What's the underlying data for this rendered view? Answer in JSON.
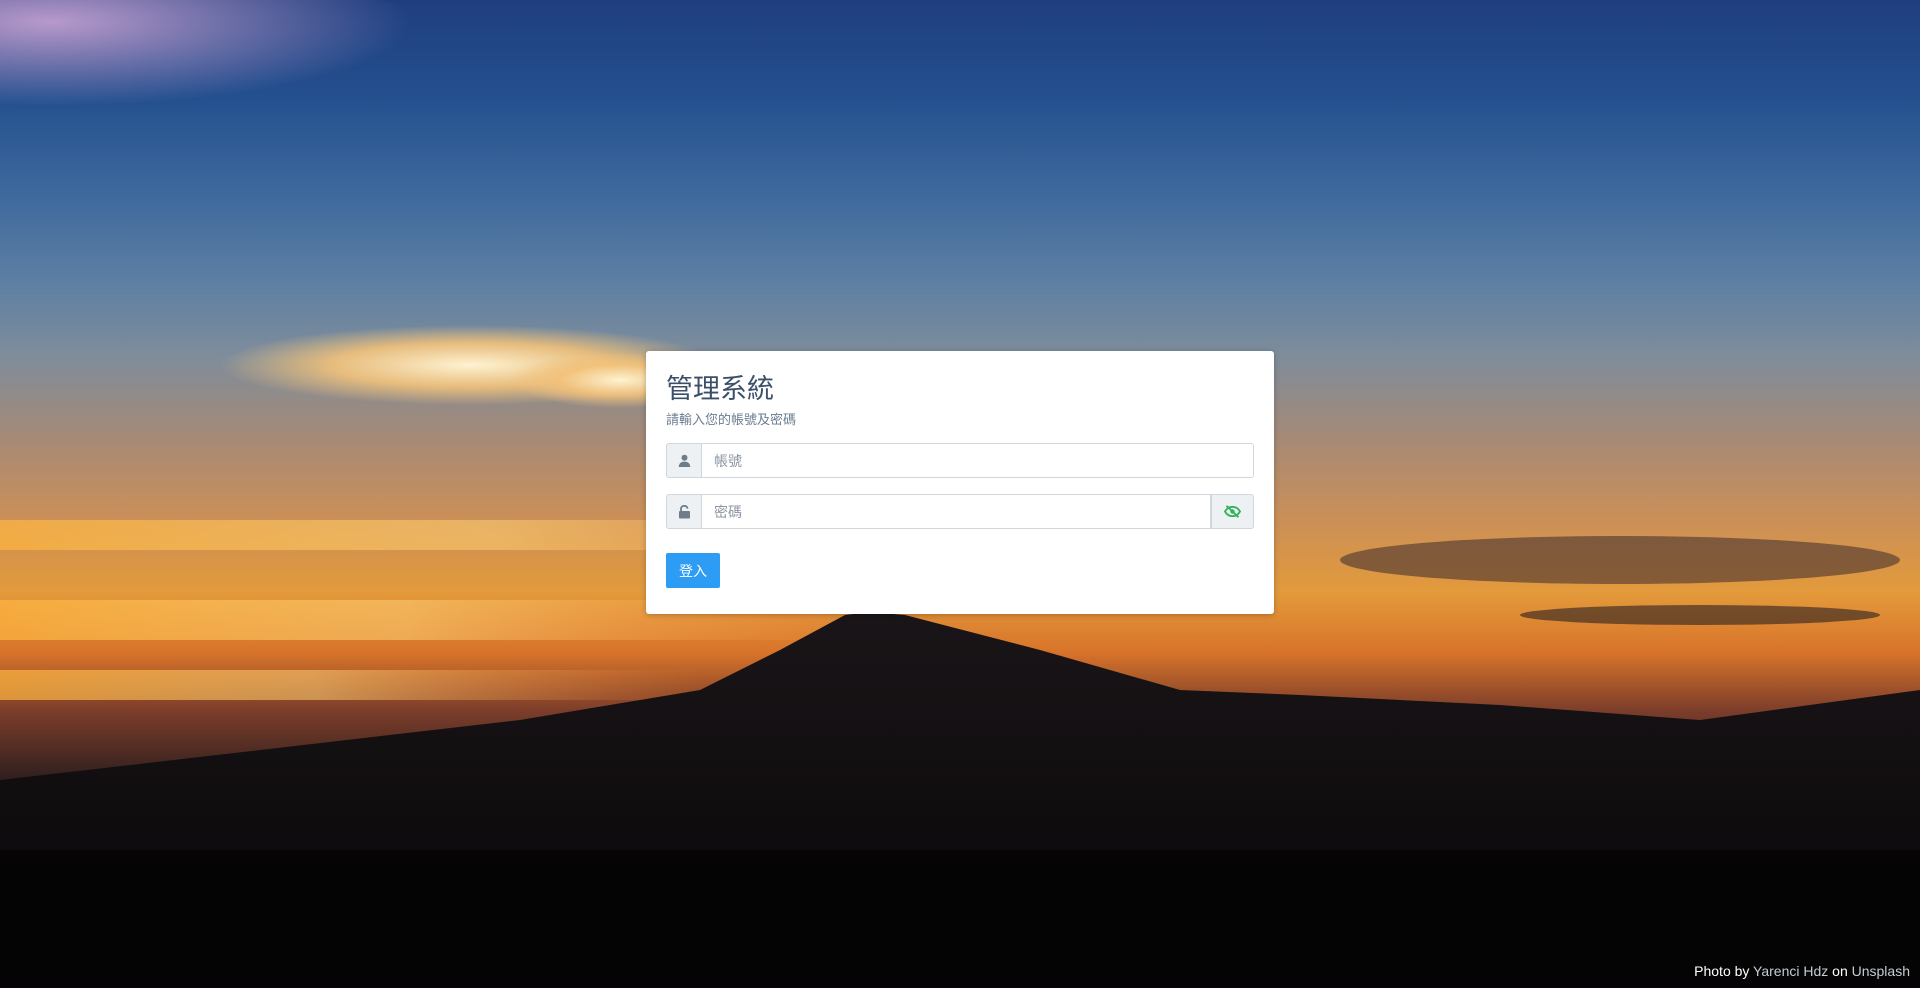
{
  "login": {
    "title": "管理系統",
    "subtitle": "請輸入您的帳號及密碼",
    "username_placeholder": "帳號",
    "password_placeholder": "密碼",
    "submit_label": "登入"
  },
  "icons": {
    "username": "user-icon",
    "password": "unlock-icon",
    "toggle": "eye-slash-icon"
  },
  "colors": {
    "primary_button": "#2d9cf5",
    "toggle_icon": "#2fb35a"
  },
  "credit": {
    "prefix": "Photo by",
    "author": "Yarenci Hdz",
    "middle": "on",
    "site": "Unsplash"
  }
}
